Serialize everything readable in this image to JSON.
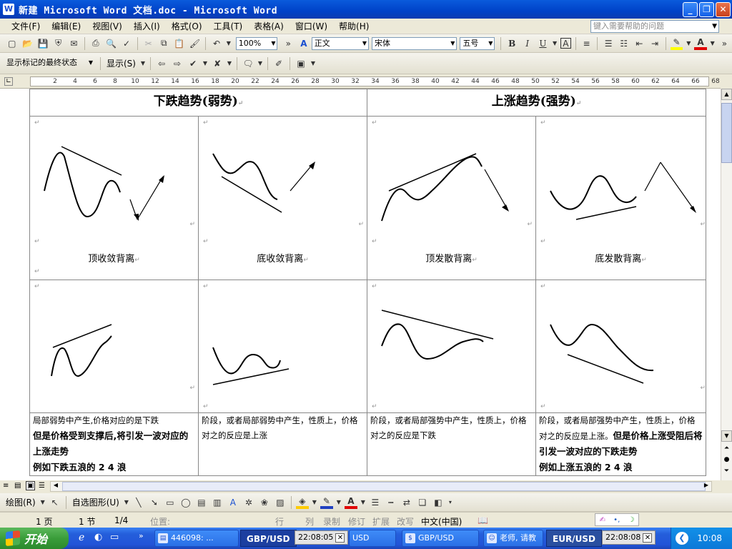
{
  "window": {
    "title": "新建 Microsoft Word 文档.doc - Microsoft Word",
    "app_icon": "W",
    "controls": [
      "minimize-icon",
      "restore-icon",
      "close-icon"
    ]
  },
  "menu": {
    "items": [
      "文件(F)",
      "编辑(E)",
      "视图(V)",
      "插入(I)",
      "格式(O)",
      "工具(T)",
      "表格(A)",
      "窗口(W)",
      "帮助(H)"
    ],
    "help_placeholder": "键入需要帮助的问题"
  },
  "toolbar_standard": {
    "zoom": "100%",
    "style": "正文",
    "font": "宋体",
    "size": "五号",
    "bold": "B",
    "italic": "I",
    "underline": "U",
    "char_border": "A"
  },
  "toolbar_review": {
    "markup_select": "显示标记的最终状态",
    "show_menu": "显示(S)"
  },
  "ruler": {
    "numbers": [
      "2",
      "4",
      "6",
      "8",
      "10",
      "12",
      "14",
      "16",
      "18",
      "20",
      "22",
      "24",
      "26",
      "28",
      "30",
      "32",
      "34",
      "36",
      "38",
      "40",
      "42",
      "44",
      "46",
      "48",
      "50",
      "52",
      "54",
      "56",
      "58",
      "60",
      "62",
      "64",
      "66",
      "68"
    ]
  },
  "document": {
    "header_left": "下跌趋势(弱势)",
    "header_right": "上涨趋势(强势)",
    "paragraph_mark": "↵",
    "row1_labels": [
      "顶收敛背离",
      "底收敛背离",
      "顶发散背离",
      "底发散背离"
    ],
    "desc1_line1": "局部弱势中产生,价格对应的是下跌",
    "desc1_bold1": "但是价格受到支撑后,将引发一波对应的上涨走势",
    "desc1_bold2": "例如下跌五浪的 2  4 浪",
    "desc2": "阶段，或者局部弱势中产生，性质上，价格对之的反应是上涨",
    "desc3": "阶段，或者局部强势中产生，性质上，价格对之的反应是下跌",
    "desc4_normal": "阶段，或者局部强势中产生，性质上，价格对之的反应是上涨。",
    "desc4_bold1": "但是价格上涨受阻后将引发一波对应的下跌走势",
    "desc4_bold2": "例如上涨五浪的 2  4 浪"
  },
  "drawing_toolbar": {
    "draw_label": "绘图(R)",
    "autoshape_label": "自选图形(U)"
  },
  "status": {
    "page": "1 页",
    "section": "1 节",
    "page_of": "1/4",
    "position": "位置:",
    "line": "行",
    "column": "列",
    "record": "录制",
    "revise": "修订",
    "extend": "扩展",
    "overwrite": "改写",
    "language": "中文(中国)"
  },
  "taskbar": {
    "start": "开始",
    "task1": "446098: ...",
    "quote1": "GBP/USD",
    "time1": "22:08:05",
    "task2_suffix": "USD",
    "task3": "GBP/USD",
    "task4": "老师, 请教",
    "quote2": "EUR/USD",
    "time2": "22:08:08",
    "clock": "10:08"
  },
  "colors": {
    "titlebar": "#0a5bdc",
    "taskbar": "#245edb",
    "start_button": "#3a9d3a"
  }
}
